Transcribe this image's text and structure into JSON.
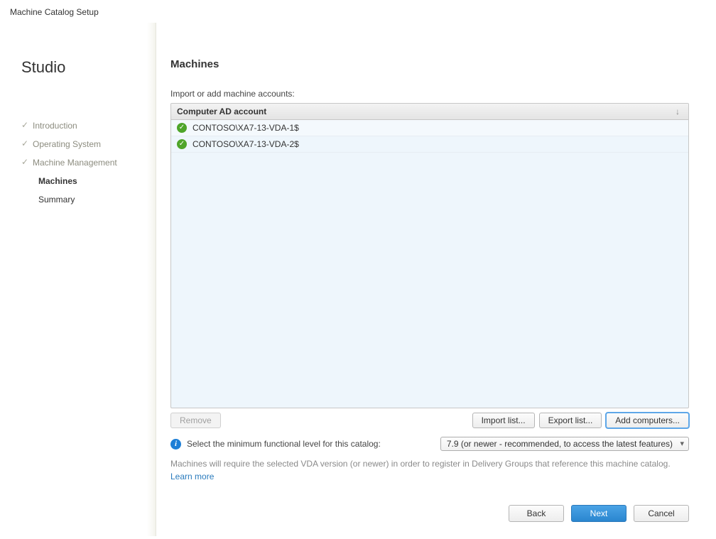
{
  "window_title": "Machine Catalog Setup",
  "sidebar": {
    "title": "Studio",
    "steps": [
      {
        "label": "Introduction",
        "state": "completed"
      },
      {
        "label": "Operating System",
        "state": "completed"
      },
      {
        "label": "Machine Management",
        "state": "completed"
      },
      {
        "label": "Machines",
        "state": "current"
      },
      {
        "label": "Summary",
        "state": "pending"
      }
    ]
  },
  "content": {
    "heading": "Machines",
    "subheading": "Import or add machine accounts:",
    "column_header": "Computer AD account",
    "rows": [
      {
        "account": "CONTOSO\\XA7-13-VDA-1$"
      },
      {
        "account": "CONTOSO\\XA7-13-VDA-2$"
      }
    ],
    "remove_label": "Remove",
    "import_label": "Import list...",
    "export_label": "Export list...",
    "add_label": "Add computers...",
    "min_level_label": "Select the minimum functional level for this catalog:",
    "min_level_value": "7.9 (or newer - recommended, to access the latest features)",
    "hint": "Machines will require the selected VDA version (or newer) in order to register in Delivery Groups that reference this machine catalog.",
    "learn_more": "Learn more"
  },
  "footer": {
    "back": "Back",
    "next": "Next",
    "cancel": "Cancel"
  }
}
